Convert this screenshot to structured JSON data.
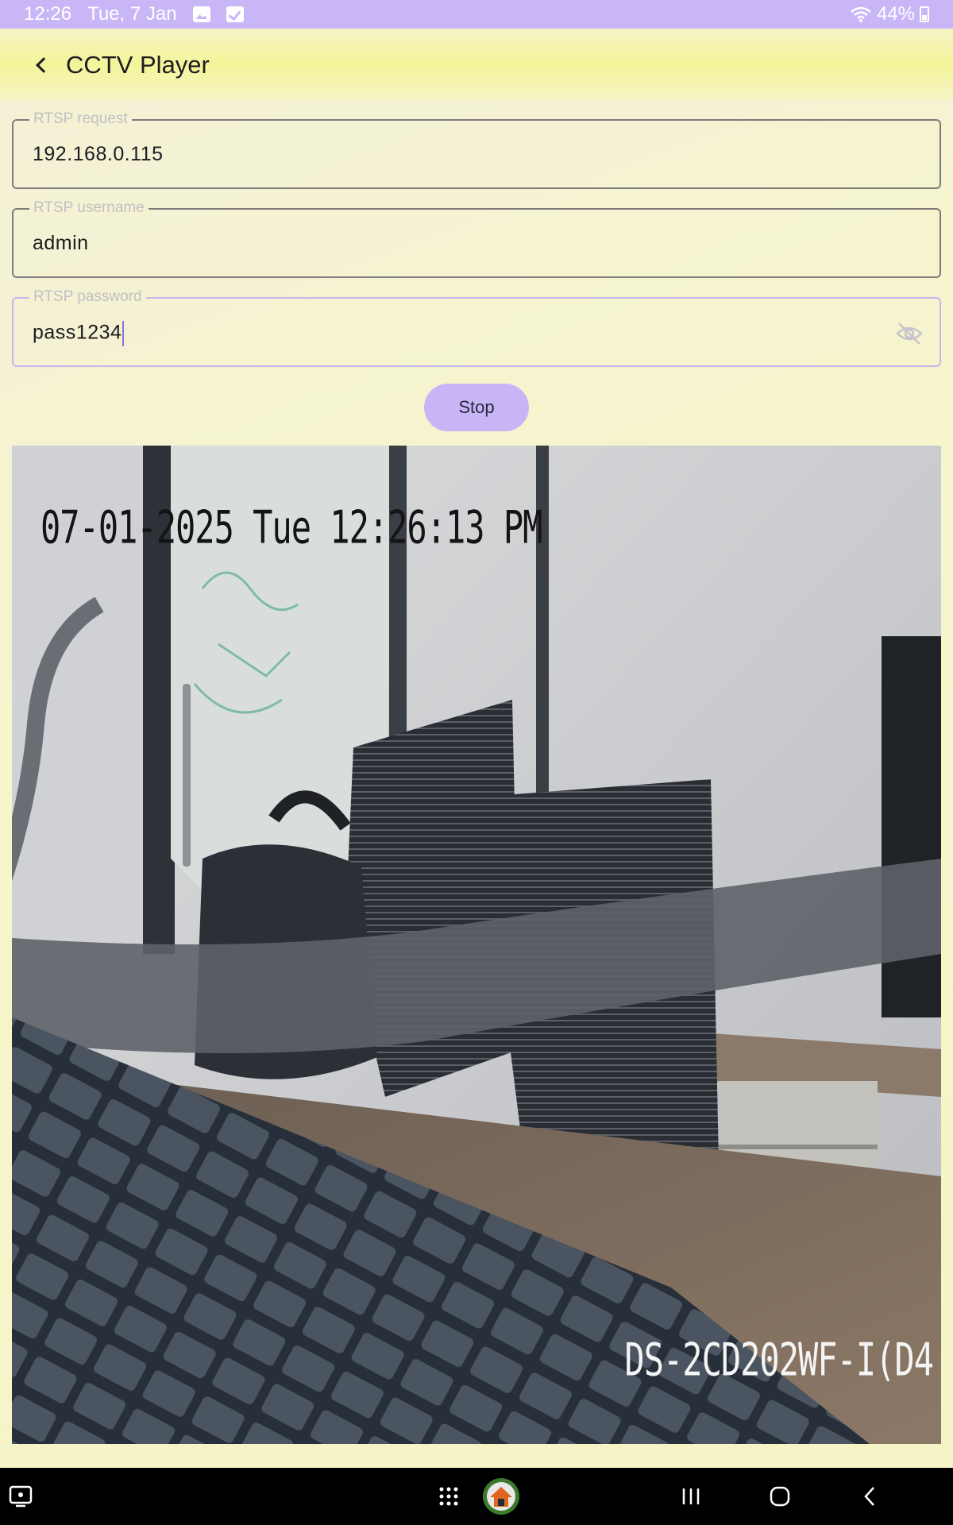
{
  "status_bar": {
    "time": "12:26",
    "date": "Tue, 7 Jan",
    "battery": "44%",
    "notification_icons": [
      "gallery-icon",
      "check-icon"
    ],
    "right_icons": [
      "wifi-icon",
      "battery-icon"
    ]
  },
  "app_bar": {
    "title": "CCTV Player",
    "back_icon": "chevron-left-icon"
  },
  "form": {
    "request": {
      "label": "RTSP request",
      "value": "192.168.0.115"
    },
    "username": {
      "label": "RTSP username",
      "value": "admin"
    },
    "password": {
      "label": "RTSP password",
      "value": "pass1234",
      "toggle_icon": "eye-off-icon"
    }
  },
  "actions": {
    "stop_label": "Stop"
  },
  "video": {
    "osd_timestamp": "07-01-2025 Tue 12:26:13 PM",
    "osd_model": "DS-2CD202WF-I(D4"
  },
  "nav_bar": {
    "icons": [
      "screenshot-icon",
      "app-drawer-icon",
      "app-shortcut-icon",
      "recents-icon",
      "home-icon",
      "back-icon"
    ]
  },
  "colors": {
    "accent": "#c8b5f6",
    "status_bar": "#c9b6f7",
    "background": "#f5f4c6",
    "text": "#1d1b20"
  }
}
